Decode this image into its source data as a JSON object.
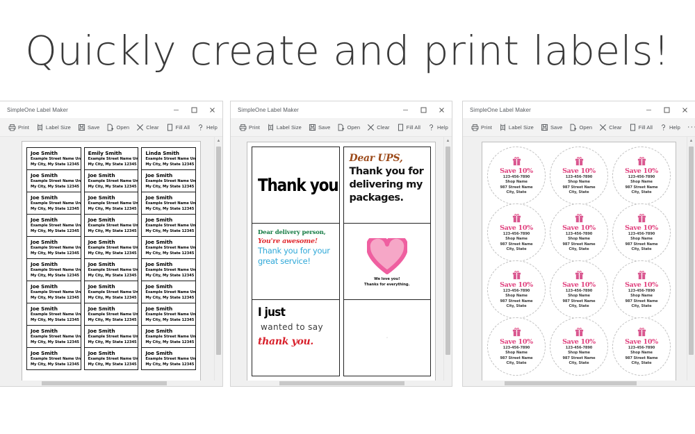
{
  "headline": "Quickly create and print labels!",
  "window_title": "SimpleOne Label Maker",
  "toolbar": {
    "items": [
      {
        "label": "Print",
        "icon": "printer-icon"
      },
      {
        "label": "Label Size",
        "icon": "label-size-icon"
      },
      {
        "label": "Save",
        "icon": "save-icon"
      },
      {
        "label": "Open",
        "icon": "open-icon"
      },
      {
        "label": "Clear",
        "icon": "clear-icon"
      },
      {
        "label": "Fill All",
        "icon": "fill-all-icon"
      },
      {
        "label": "Help",
        "icon": "help-icon"
      }
    ],
    "overflow": "···"
  },
  "window_controls": {
    "minimize": "minimize-button",
    "maximize": "maximize-button",
    "close": "close-button"
  },
  "colors": {
    "brand_pink": "#e0417e",
    "heart_outline": "#ef5fa0",
    "heart_fill": "#f6a7c7",
    "ups_brown": "#9c4a1a",
    "green": "#137a42",
    "red": "#e0262c",
    "teal": "#2fa8d8",
    "headline_gray": "#3a3a3a"
  },
  "address_window": {
    "street": "Example Street Name Unit B",
    "citystate": "My City, My State 12345",
    "rows": 10,
    "columns": 3,
    "names": [
      [
        "Joe Smith",
        "Emily Smith",
        "Linda Smith"
      ],
      [
        "Joe Smith",
        "Joe Smith",
        "Joe Smith"
      ],
      [
        "Joe Smith",
        "Joe Smith",
        "Joe Smith"
      ],
      [
        "Joe Smith",
        "Joe Smith",
        "Joe Smith"
      ],
      [
        "Joe Smith",
        "Joe Smith",
        "Joe Smith"
      ],
      [
        "Joe Smith",
        "Joe Smith",
        "Joe Smith"
      ],
      [
        "Joe Smith",
        "Joe Smith",
        "Joe Smith"
      ],
      [
        "Joe Smith",
        "Joe Smith",
        "Joe Smith"
      ],
      [
        "Joe Smith",
        "Joe Smith",
        "Joe Smith"
      ],
      [
        "Joe Smith",
        "Joe Smith",
        "Joe Smith"
      ]
    ]
  },
  "message_window": {
    "thank_you": "Thank you!",
    "ups": {
      "salutation": "Dear UPS,",
      "body_line1": "Thank you for",
      "body_line2": "delivering my",
      "body_line3": "packages."
    },
    "delivery_person": {
      "line1": "Dear delivery person,",
      "line2": "You're awesome!",
      "line3": "Thank you for your",
      "line4": "great service!"
    },
    "heart": {
      "icon": "heart-icon",
      "caption_line1": "We love you!",
      "caption_line2": "Thanks for everything."
    },
    "i_just": {
      "line1": "I just",
      "line2": "wanted to say",
      "line3": "thank you."
    },
    "empty_label_mark": "°°"
  },
  "circle_window": {
    "rows": 4,
    "columns": 3,
    "label": {
      "icon": "gift-icon",
      "offer": "Save 10%",
      "phone": "123-456-7890",
      "shop": "Shop Name",
      "street": "987 Street Name",
      "citystate": "City, State"
    }
  }
}
